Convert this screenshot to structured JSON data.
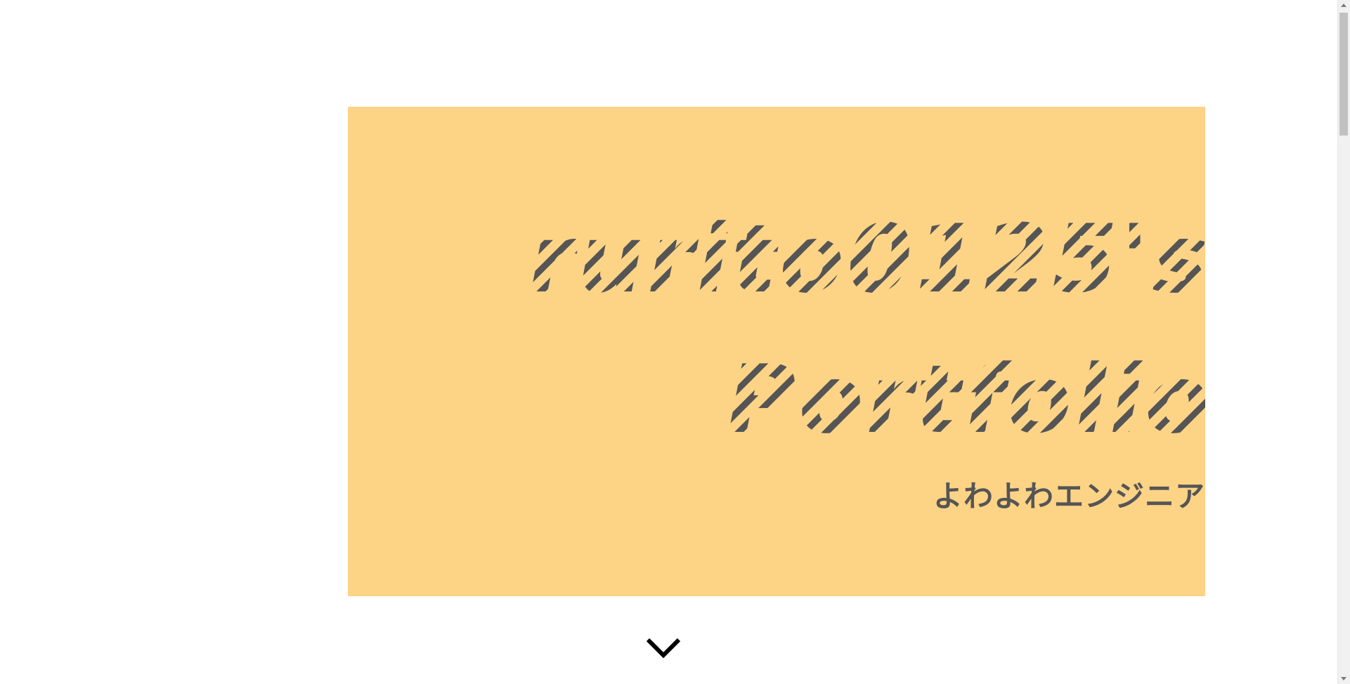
{
  "hero": {
    "background_color": "#fdd386",
    "title_line1": "rurito0125's",
    "title_line2": "Portfolio",
    "subtitle": "よわよわエンジニア",
    "text_color": "#555555"
  },
  "scroll_indicator": {
    "icon": "chevron-down-icon"
  },
  "scrollbar": {
    "position": 0
  }
}
